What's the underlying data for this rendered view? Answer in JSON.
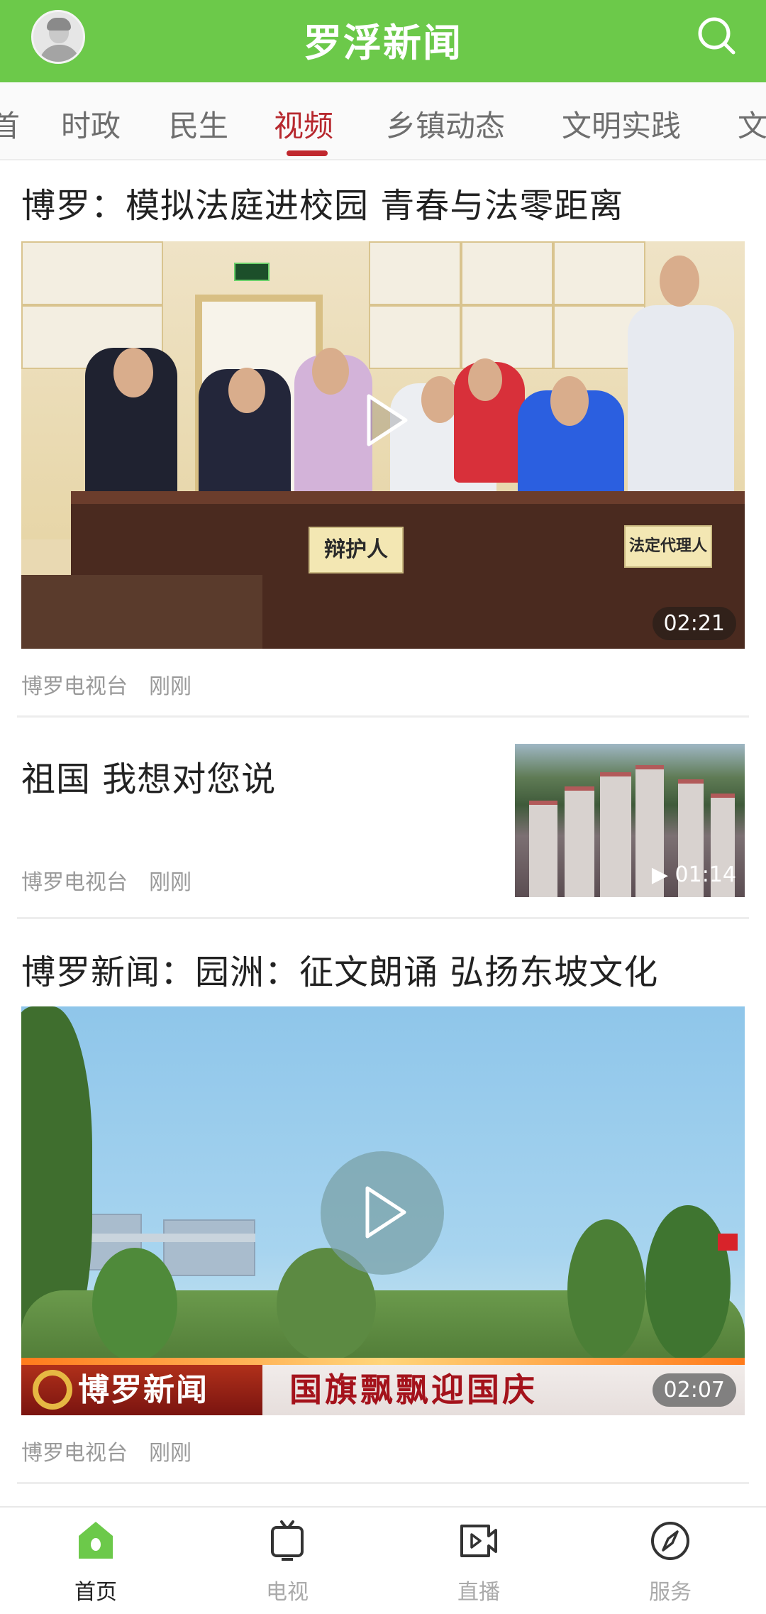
{
  "header": {
    "title": "罗浮新闻",
    "avatar": "user-avatar-icon",
    "search_icon": "search-icon"
  },
  "tabs": [
    {
      "label": "首"
    },
    {
      "label": "时政"
    },
    {
      "label": "民生"
    },
    {
      "label": "视频",
      "active": true
    },
    {
      "label": "乡镇动态"
    },
    {
      "label": "文明实践"
    },
    {
      "label": "文"
    }
  ],
  "feed": [
    {
      "title": "博罗：模拟法庭进校园 青春与法零距离",
      "layout": "large",
      "duration": "02:21",
      "sign_labels": [
        "辩护人",
        "法定代理人"
      ],
      "source": "博罗电视台",
      "time": "刚刚"
    },
    {
      "title": "祖国 我想对您说",
      "layout": "thumb-right",
      "duration": "01:14",
      "source": "博罗电视台",
      "time": "刚刚"
    },
    {
      "title": "博罗新闻：园洲：征文朗诵 弘扬东坡文化",
      "layout": "large",
      "duration": "02:07",
      "banner_left": "博罗新闻",
      "banner_right": "国旗飘飘迎国庆",
      "source": "博罗电视台",
      "time": "刚刚"
    }
  ],
  "bottom_nav": [
    {
      "label": "首页",
      "icon": "home-icon",
      "active": true
    },
    {
      "label": "电视",
      "icon": "tv-icon"
    },
    {
      "label": "直播",
      "icon": "live-video-icon"
    },
    {
      "label": "服务",
      "icon": "compass-icon"
    }
  ],
  "colors": {
    "brand_green": "#6cc94a",
    "active_tab_red": "#b7282e",
    "meta_gray": "#999999"
  }
}
